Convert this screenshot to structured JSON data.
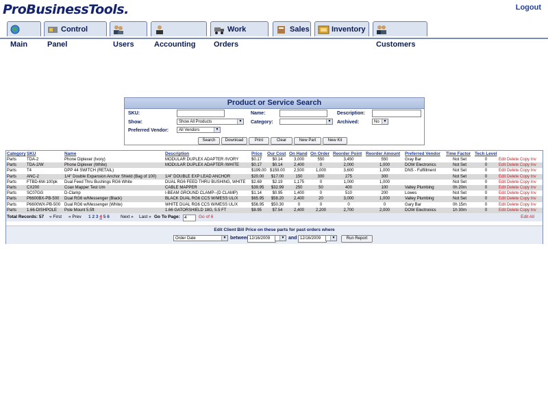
{
  "header": {
    "logo": "ProBusinessTools.",
    "logout": "Logout"
  },
  "tabs": [
    {
      "label": "Main",
      "icon": "globe-icon"
    },
    {
      "label": "Control Panel",
      "icon": "control-panel-icon"
    },
    {
      "label": "Users",
      "icon": "users-icon"
    },
    {
      "label": "Accounting",
      "icon": "accounting-icon"
    },
    {
      "label": "Work Orders",
      "icon": "truck-icon"
    },
    {
      "label": "Sales",
      "icon": "sales-icon"
    },
    {
      "label": "Inventory",
      "icon": "inventory-icon"
    },
    {
      "label": "Customers",
      "icon": "customers-icon"
    }
  ],
  "search": {
    "title": "Product or Service Search",
    "sku_label": "SKU:",
    "name_label": "Name:",
    "description_label": "Description:",
    "show_label": "Show:",
    "show_value": "Show All Products",
    "category_label": "Category:",
    "archived_label": "Archived:",
    "archived_value": "No",
    "vendor_label": "Preferred Vendor:",
    "vendor_value": "All Vendors",
    "buttons": [
      "Search",
      "Download",
      "Print",
      "Clear",
      "New Part",
      "New Kit"
    ]
  },
  "table": {
    "headers": [
      "Category",
      "SKU",
      "Name",
      "Description",
      "Price",
      "Our Cost",
      "On Hand",
      "On Order",
      "Reorder Point",
      "Reorder Amount",
      "Preferred Vendor",
      "Time Factor",
      "Tech Level"
    ],
    "row_actions": [
      "Edit",
      "Delete",
      "Copy",
      "Inv"
    ],
    "rows": [
      [
        "Parts",
        "TDA-2",
        "Phone Diplexer (Ivory)",
        "MODULAR DUPLEX ADAPTER /IVORY",
        "$0.17",
        "$0.14",
        "3,000",
        "550",
        "3,450",
        "550",
        "Gray Bar",
        "Not Set",
        "0"
      ],
      [
        "Parts",
        "TDA-2/W",
        "Phone Diplexer (White)",
        "MODULAR DUPLEX ADAPTER /WHITE",
        "$0.17",
        "$0.14",
        "2,400",
        "0",
        "2,000",
        "1,000",
        "DOW Electronics",
        "Not Set",
        "0"
      ],
      [
        "Parts",
        "T4",
        "DPP 44 SWITCH (RETAIL)",
        "",
        "$199.00",
        "$159.00",
        "2,500",
        "1,000",
        "3,600",
        "1,000",
        "DNS - Fulfillment",
        "Not Set",
        "0"
      ],
      [
        "Parts",
        "ANC-2",
        "1/4\" Double Expansion Anchor Shield (Bag of 100)",
        "1/4\" DOUBLE EXP LEAD ANCHOR",
        "$20.00",
        "$17.00",
        "150",
        "300",
        "275",
        "300",
        "",
        "Not Set",
        "0"
      ],
      [
        "Parts",
        "FTBD-6W-100pk",
        "Dual Feed Thru Bushings RG6 White",
        "DUAL RG6 FEED THRU BUSHING, WHITE",
        "$2.69",
        "$2.19",
        "1,175",
        "0",
        "1,000",
        "1,000",
        "",
        "Not Set",
        "0"
      ],
      [
        "Parts",
        "CX200",
        "Coax Mapper Test  Um",
        "CABLE MAPPER",
        "$39.95",
        "$32.99",
        "250",
        "50",
        "400",
        "100",
        "Valley Plumbing",
        "0h 20m",
        "0"
      ],
      [
        "Parts",
        "SC07GG",
        "D-Clamp",
        "I-BEAM GROUND CLAMP--(D CLAMP)",
        "$1.14",
        "$0.95",
        "1,400",
        "0",
        "510",
        "200",
        "Lowes",
        "Not Set",
        "0"
      ],
      [
        "Parts",
        "P6600BX-PB-500",
        "Dual RG6 w/Messenger (Black)",
        "BLACK DUAL RG6 CCS W/MESS UL/X",
        "$65.95",
        "$58.20",
        "2,400",
        "20",
        "3,000",
        "1,000",
        "Valley Plumbing",
        "Not Set",
        "0"
      ],
      [
        "Parts",
        "P6600WX-PB-500",
        "Dual RG6 w/Messenger (White)",
        "WHITE DUAL RG6 CCS W/MESS UL/X",
        "$56.95",
        "$50.30",
        "0",
        "0",
        "0",
        "0",
        "Gary Bar",
        "0h 15m",
        "0"
      ],
      [
        "Parts",
        "1.66-DISHPOLE",
        "Pole Mount 5.5ft",
        "1.66 GATORSHIELD 18G, 5.5 FT",
        "$8.95",
        "$7.54",
        "2,400",
        "2,200",
        "2,700",
        "2,000",
        "DOW Electronics",
        "1h 30m",
        "0"
      ]
    ]
  },
  "pager": {
    "total_label": "Total Records: 57",
    "first": "« First",
    "prev": "« Prev",
    "pages": [
      "1",
      "2",
      "3",
      "4",
      "5",
      "6"
    ],
    "current_page": "4",
    "next": "Next »",
    "last": "Last »",
    "goto_label": "Go To Page:",
    "goto_value": "4",
    "of_label": "Go of 6",
    "edit_all": "Edit All"
  },
  "bill": {
    "label": "Edit Client Bill Price on these parts for past orders where",
    "field_value": "Order Date",
    "between": "between",
    "date_from": "12/16/2009",
    "and": "and",
    "date_to": "12/16/2009",
    "run": "Run Report"
  }
}
